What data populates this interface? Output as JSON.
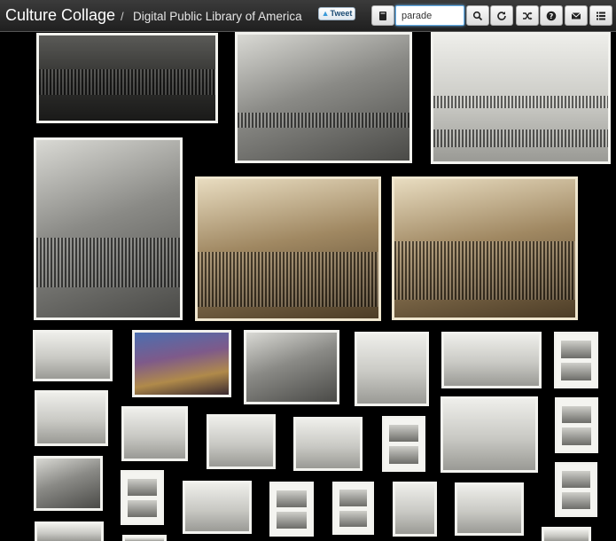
{
  "header": {
    "brand": "Culture Collage",
    "separator": "/",
    "subtitle": "Digital Public Library of America",
    "tweet_label": "Tweet"
  },
  "search": {
    "value": "parade"
  },
  "toolbar": {
    "icons": [
      "book-icon",
      "search-icon",
      "refresh-icon",
      "shuffle-icon",
      "help-icon",
      "mail-icon",
      "list-icon"
    ]
  },
  "colors": {
    "topbar": "#2c2c2c",
    "background": "#000000",
    "accent": "#66afe9"
  }
}
